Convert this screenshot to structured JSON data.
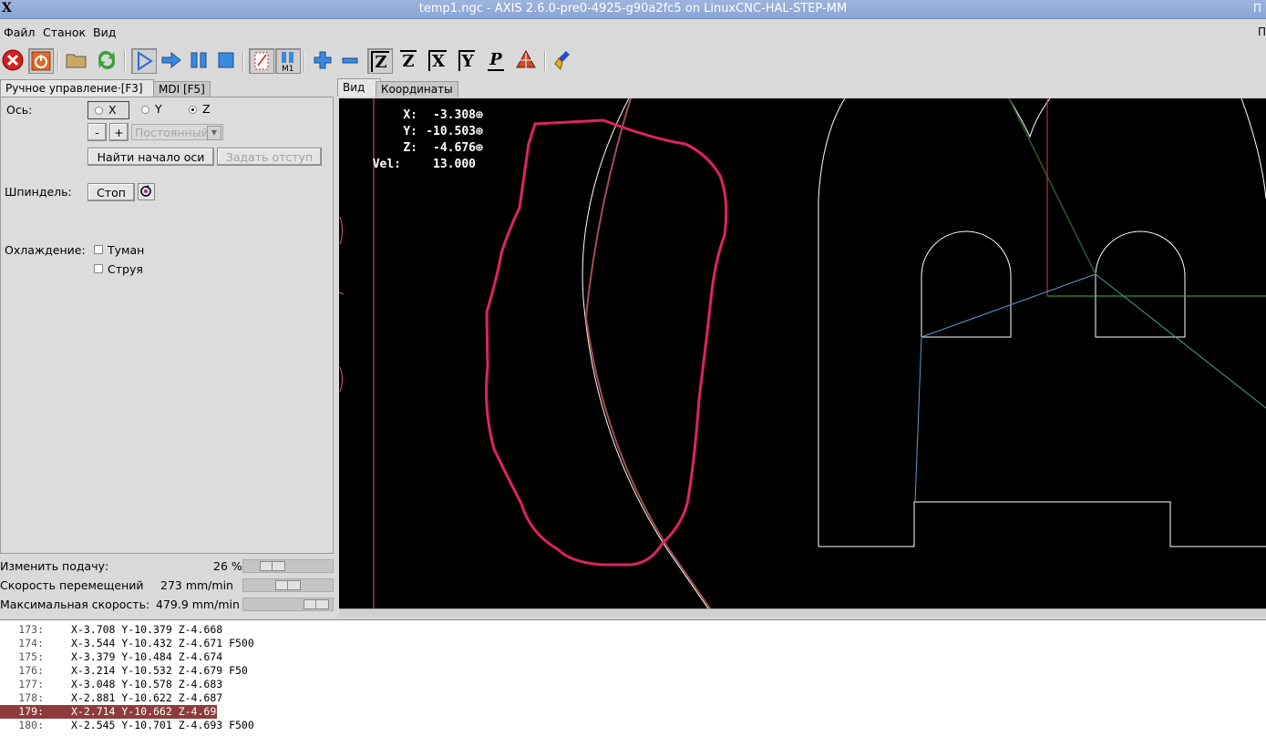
{
  "window": {
    "title": "temp1.ngc - AXIS 2.6.0-pre0-4925-g90a2fc5 on LinuxCNC-HAL-STEP-MM",
    "corner_glyph": "П"
  },
  "menu": [
    "Файл",
    "Станок",
    "Вид"
  ],
  "toolbar": [
    "estop-icon",
    "power-icon",
    "open-folder-icon",
    "reload-icon",
    "run-icon",
    "step-icon",
    "pause-icon",
    "stop-icon",
    "block-delete-icon",
    "optional-stop-icon",
    "zoom-in-icon",
    "zoom-out-icon",
    "view-z-icon",
    "view-z2-icon",
    "view-x-icon",
    "view-y-icon",
    "view-p-icon",
    "toggle-view-icon",
    "clear-plot-icon"
  ],
  "toolbar_labels": {
    "z": "Z",
    "z2": "Z",
    "x": "X",
    "y": "Y",
    "p": "P",
    "m1": "M1"
  },
  "left_tabs": [
    "Ручное управление·[F3]",
    "MDI [F5]"
  ],
  "manual": {
    "axis_label": "Ось:",
    "axes": [
      "X",
      "Y",
      "Z"
    ],
    "selected_axis": "Z",
    "minus": "-",
    "plus": "+",
    "jog_mode": "Постоянный",
    "home_button": "Найти начало оси",
    "touch_off_button": "Задать отступ",
    "spindle_label": "Шпиндель:",
    "spindle_stop": "Стоп",
    "coolant_label": "Охлаждение:",
    "mist": "Туман",
    "flood": "Струя"
  },
  "sliders": {
    "feed_label": "Изменить подачу:",
    "feed_value": "26 %",
    "feed_fraction": 0.26,
    "jog_label": "Скорость перемещений",
    "jog_value": "273 mm/min",
    "jog_fraction": 0.52,
    "max_label": "Максимальная скорость:",
    "max_value": "479.9 mm/min",
    "max_fraction": 0.97
  },
  "view_tabs": [
    "Вид",
    "Координаты"
  ],
  "dro": {
    "x_label": "X:",
    "x": "-3.308",
    "y_label": "Y:",
    "y": "-10.503",
    "z_label": "Z:",
    "z": "-4.676",
    "vel_label": "Vel:",
    "vel": "13.000"
  },
  "code_lines": [
    {
      "n": "173:",
      "t": "X-3.708 Y-10.379 Z-4.668"
    },
    {
      "n": "174:",
      "t": "X-3.544 Y-10.432 Z-4.671 F500"
    },
    {
      "n": "175:",
      "t": "X-3.379 Y-10.484 Z-4.674"
    },
    {
      "n": "176:",
      "t": "X-3.214 Y-10.532 Z-4.679 F50"
    },
    {
      "n": "177:",
      "t": "X-3.048 Y-10.578 Z-4.683"
    },
    {
      "n": "178:",
      "t": "X-2.881 Y-10.622 Z-4.687"
    },
    {
      "n": "179:",
      "t": "X-2.714 Y-10.662 Z-4.69"
    },
    {
      "n": "180:",
      "t": "X-2.545 Y-10.701 Z-4.693 F500"
    }
  ],
  "highlighted_line": "179:",
  "colors": {
    "highlight": "#8e3b3b",
    "toolpath": "#e0245e",
    "background": "#000000"
  }
}
